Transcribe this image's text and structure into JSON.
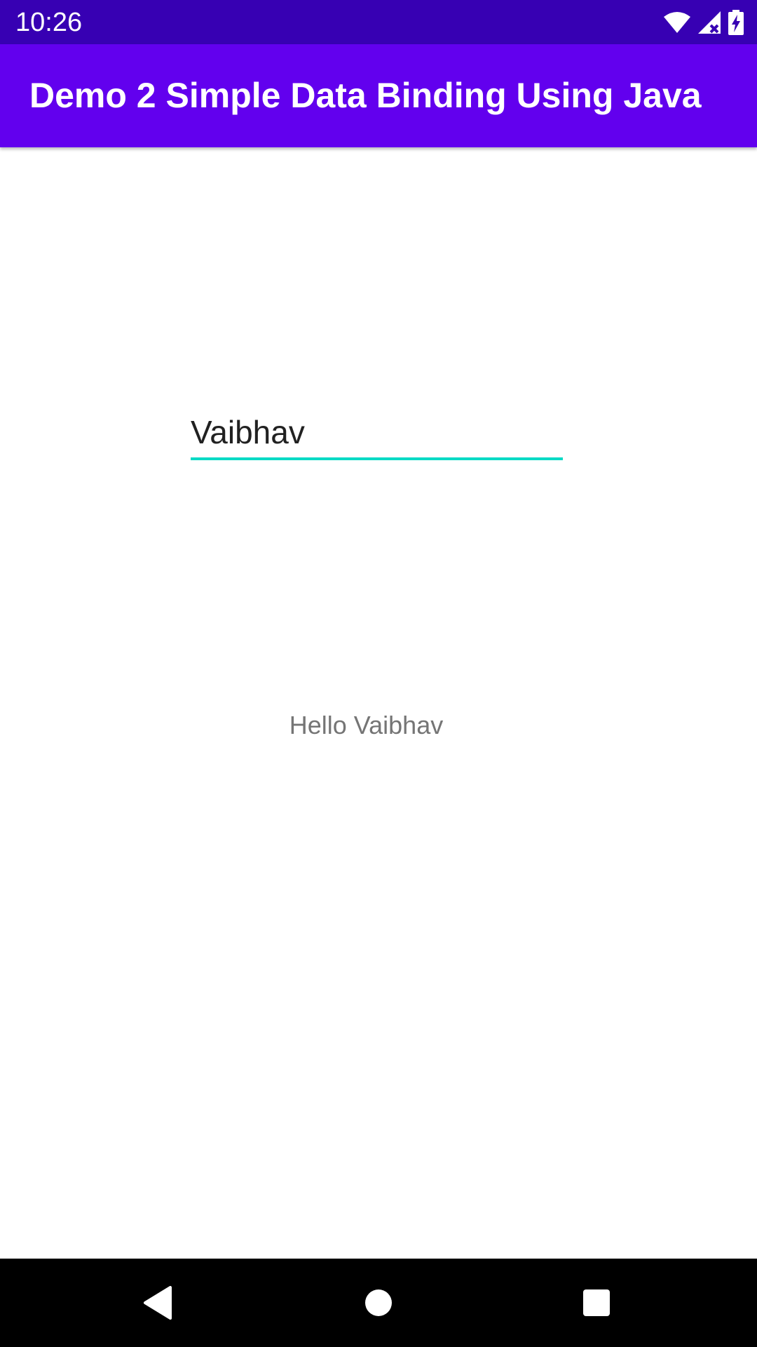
{
  "status_bar": {
    "time": "10:26",
    "icons": [
      "wifi-icon",
      "signal-icon",
      "battery-charging-icon"
    ],
    "color": "#3700B3"
  },
  "app_bar": {
    "title": "Demo 2 Simple Data Binding Using Java",
    "color": "#6200EE"
  },
  "main": {
    "name_input": {
      "value": "Vaibhav",
      "underline_color": "#03DAC5"
    },
    "greeting": "Hello Vaibhav"
  },
  "nav_bar": {
    "buttons": [
      "back-icon",
      "home-icon",
      "recents-icon"
    ]
  }
}
